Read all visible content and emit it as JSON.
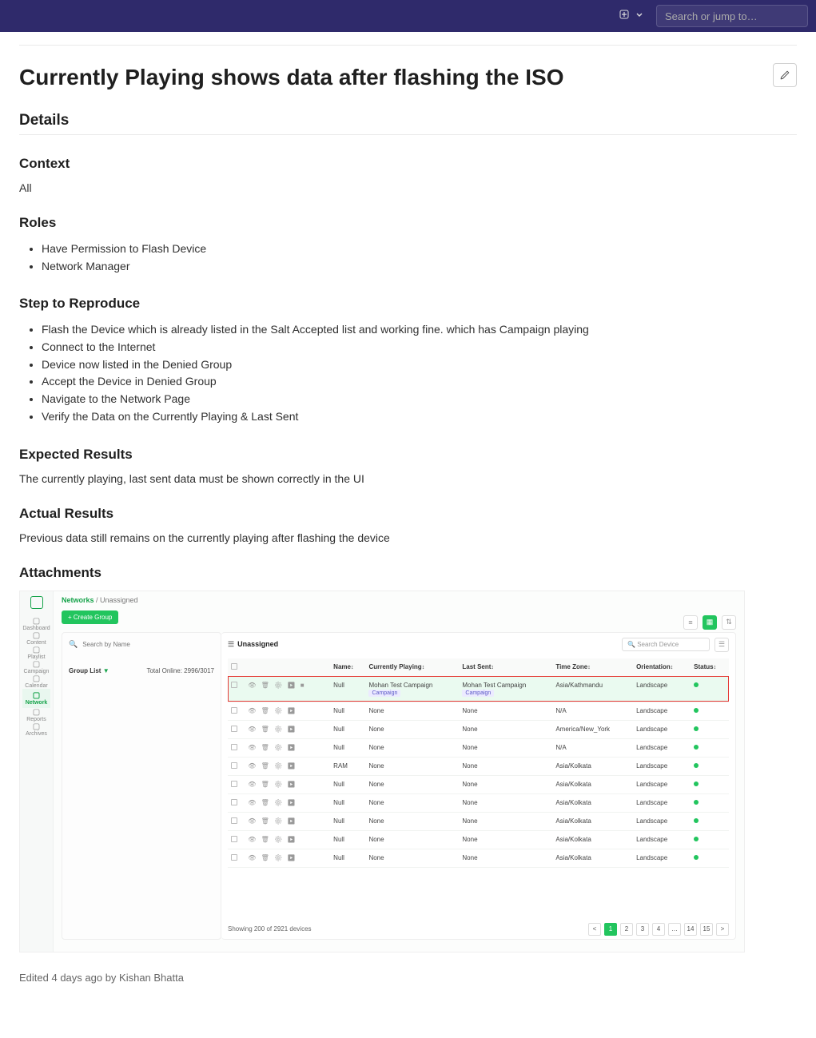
{
  "topbar": {
    "search_placeholder": "Search or jump to…"
  },
  "issue": {
    "title": "Currently Playing shows data after flashing the ISO",
    "details_heading": "Details",
    "context_heading": "Context",
    "context_value": "All",
    "roles_heading": "Roles",
    "roles": [
      "Have Permission to Flash Device",
      "Network Manager"
    ],
    "steps_heading": "Step to Reproduce",
    "steps": [
      "Flash the Device which is already listed in the Salt Accepted list and working fine. which has Campaign playing",
      "Connect to the Internet",
      "Device now listed in the Denied Group",
      "Accept the Device in Denied Group",
      "Navigate to the Network Page",
      "Verify the Data on the Currently Playing & Last Sent"
    ],
    "expected_heading": "Expected Results",
    "expected_text": "The currently playing, last sent data must be shown correctly in the UI",
    "actual_heading": "Actual Results",
    "actual_text": "Previous data still remains on the currently playing after flashing the device",
    "attachments_heading": "Attachments"
  },
  "attachment": {
    "breadcrumb_root": "Networks",
    "breadcrumb_sep": " / ",
    "breadcrumb_leaf": "Unassigned",
    "create_group": "Create Group",
    "sidebar_items": [
      "Dashboard",
      "Content",
      "Playlist",
      "Campaign",
      "Calendar",
      "Network",
      "Reports",
      "Archives"
    ],
    "sidebar_active_index": 5,
    "left_search_placeholder": "Search by Name",
    "group_list_label": "Group List",
    "total_online": "Total Online: 2996/3017",
    "unassigned_label": "Unassigned",
    "search_device_placeholder": "Search Device",
    "columns": [
      "",
      "",
      "Name",
      "Currently Playing",
      "Last Sent",
      "Time Zone",
      "Orientation",
      "Status"
    ],
    "rows": [
      {
        "name": "Null",
        "cp": "Mohan Test Campaign",
        "cp_tag": "Campaign",
        "ls": "Mohan Test Campaign",
        "ls_tag": "Campaign",
        "tz": "Asia/Kathmandu",
        "ori": "Landscape",
        "hl": true,
        "extra_icon": true
      },
      {
        "name": "Null",
        "cp": "None",
        "ls": "None",
        "tz": "N/A",
        "ori": "Landscape"
      },
      {
        "name": "Null",
        "cp": "None",
        "ls": "None",
        "tz": "America/New_York",
        "ori": "Landscape"
      },
      {
        "name": "Null",
        "cp": "None",
        "ls": "None",
        "tz": "N/A",
        "ori": "Landscape"
      },
      {
        "name": "RAM",
        "cp": "None",
        "ls": "None",
        "tz": "Asia/Kolkata",
        "ori": "Landscape"
      },
      {
        "name": "Null",
        "cp": "None",
        "ls": "None",
        "tz": "Asia/Kolkata",
        "ori": "Landscape"
      },
      {
        "name": "Null",
        "cp": "None",
        "ls": "None",
        "tz": "Asia/Kolkata",
        "ori": "Landscape"
      },
      {
        "name": "Null",
        "cp": "None",
        "ls": "None",
        "tz": "Asia/Kolkata",
        "ori": "Landscape"
      },
      {
        "name": "Null",
        "cp": "None",
        "ls": "None",
        "tz": "Asia/Kolkata",
        "ori": "Landscape"
      },
      {
        "name": "Null",
        "cp": "None",
        "ls": "None",
        "tz": "Asia/Kolkata",
        "ori": "Landscape"
      }
    ],
    "showing_text": "Showing 200 of 2921 devices",
    "pages": [
      "<",
      "1",
      "2",
      "3",
      "4",
      "…",
      "14",
      "15",
      ">"
    ],
    "active_page_index": 1
  },
  "edited_line": "Edited 4 days ago by Kishan Bhatta"
}
